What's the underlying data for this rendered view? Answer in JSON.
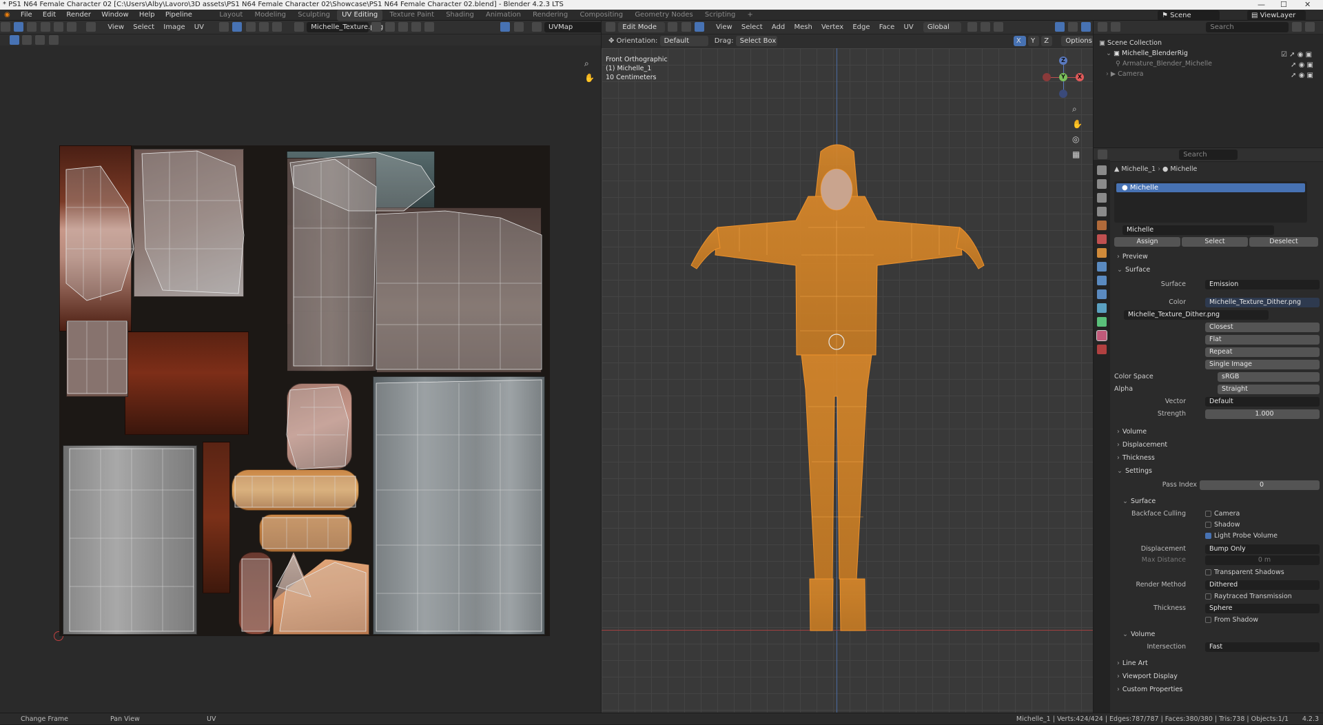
{
  "window": {
    "title": "* PS1 N64 Female Character 02 [C:\\Users\\Alby\\Lavoro\\3D assets\\PS1 N64 Female Character 02\\Showcase\\PS1 N64 Female Character 02.blend] - Blender 4.2.3 LTS"
  },
  "menu": [
    "File",
    "Edit",
    "Render",
    "Window",
    "Help",
    "Pipeline"
  ],
  "workspaces": [
    "Layout",
    "Modeling",
    "Sculpting",
    "UV Editing",
    "Texture Paint",
    "Shading",
    "Animation",
    "Rendering",
    "Compositing",
    "Geometry Nodes",
    "Scripting"
  ],
  "active_workspace": "UV Editing",
  "add_tab": "+",
  "scene": {
    "name": "Scene",
    "view_layer": "ViewLayer"
  },
  "uv_header": {
    "view": "View",
    "select": "Select",
    "image": "Image",
    "uv": "UV",
    "image_name": "Michelle_Texture.png",
    "uvmap": "UVMap"
  },
  "viewport_header": {
    "mode": "Edit Mode",
    "view": "View",
    "select": "Select",
    "add": "Add",
    "mesh": "Mesh",
    "vertex": "Vertex",
    "edge": "Edge",
    "face": "Face",
    "uv": "UV",
    "transform": "Global"
  },
  "viewport_tool": {
    "orientation_label": "Orientation:",
    "orientation_value": "Default",
    "drag_label": "Drag:",
    "drag_value": "Select Box",
    "options": "Options",
    "axes": [
      "X",
      "Y",
      "Z"
    ]
  },
  "viewport_info": {
    "view": "Front Orthographic",
    "object": "(1) Michelle_1",
    "scale": "10 Centimeters"
  },
  "gizmo": {
    "x": "X",
    "y": "Y",
    "z": "Z"
  },
  "outliner": {
    "search_placeholder": "Search",
    "collection": "Scene Collection",
    "items": [
      {
        "name": "Michelle_BlenderRig"
      },
      {
        "name": "Armature_Blender_Michelle"
      },
      {
        "name": "Camera"
      }
    ]
  },
  "properties": {
    "search_placeholder": "Search",
    "breadcrumb": [
      "Michelle_1",
      "Michelle"
    ],
    "slot": "Michelle",
    "material_name": "Michelle",
    "buttons": {
      "assign": "Assign",
      "select": "Select",
      "deselect": "Deselect"
    },
    "sections": {
      "preview": "Preview",
      "surface": "Surface",
      "volume": "Volume",
      "displacement": "Displacement",
      "thickness": "Thickness",
      "settings": "Settings",
      "surface_sub": "Surface",
      "volume_sub": "Volume",
      "line_art": "Line Art",
      "viewport_display": "Viewport Display",
      "custom_properties": "Custom Properties"
    },
    "surface": {
      "label": "Surface",
      "value": "Emission"
    },
    "color": {
      "label": "Color",
      "value": "Michelle_Texture_Dither.png"
    },
    "image": {
      "name": "Michelle_Texture_Dither.png",
      "interpolation": "Closest",
      "projection": "Flat",
      "extension": "Repeat",
      "source": "Single Image"
    },
    "color_space": {
      "label": "Color Space",
      "value": "sRGB"
    },
    "alpha": {
      "label": "Alpha",
      "value": "Straight"
    },
    "vector": {
      "label": "Vector",
      "value": "Default"
    },
    "strength": {
      "label": "Strength",
      "value": "1.000"
    },
    "pass_index": {
      "label": "Pass Index",
      "value": "0"
    },
    "backface_culling": {
      "label": "Backface Culling",
      "camera": "Camera",
      "shadow": "Shadow",
      "light_probe": "Light Probe Volume"
    },
    "displacement": {
      "label": "Displacement",
      "value": "Bump Only"
    },
    "max_distance": {
      "label": "Max Distance",
      "value": "0 m"
    },
    "transparent_shadows": "Transparent Shadows",
    "render_method": {
      "label": "Render Method",
      "value": "Dithered"
    },
    "raytraced": "Raytraced Transmission",
    "thickness": {
      "label": "Thickness",
      "value": "Sphere"
    },
    "from_shadow": "From Shadow",
    "intersection": {
      "label": "Intersection",
      "value": "Fast"
    }
  },
  "status": {
    "left1": "Change Frame",
    "left2": "Pan View",
    "left3": "UV",
    "right": "Michelle_1 | Verts:424/424 | Edges:787/787 | Faces:380/380 | Tris:738 | Objects:1/1",
    "version": "4.2.3"
  },
  "colors": {
    "accent": "#4772b3",
    "selected": "#ff8c1a",
    "header": "#303030",
    "panel": "#2b2b2b"
  }
}
